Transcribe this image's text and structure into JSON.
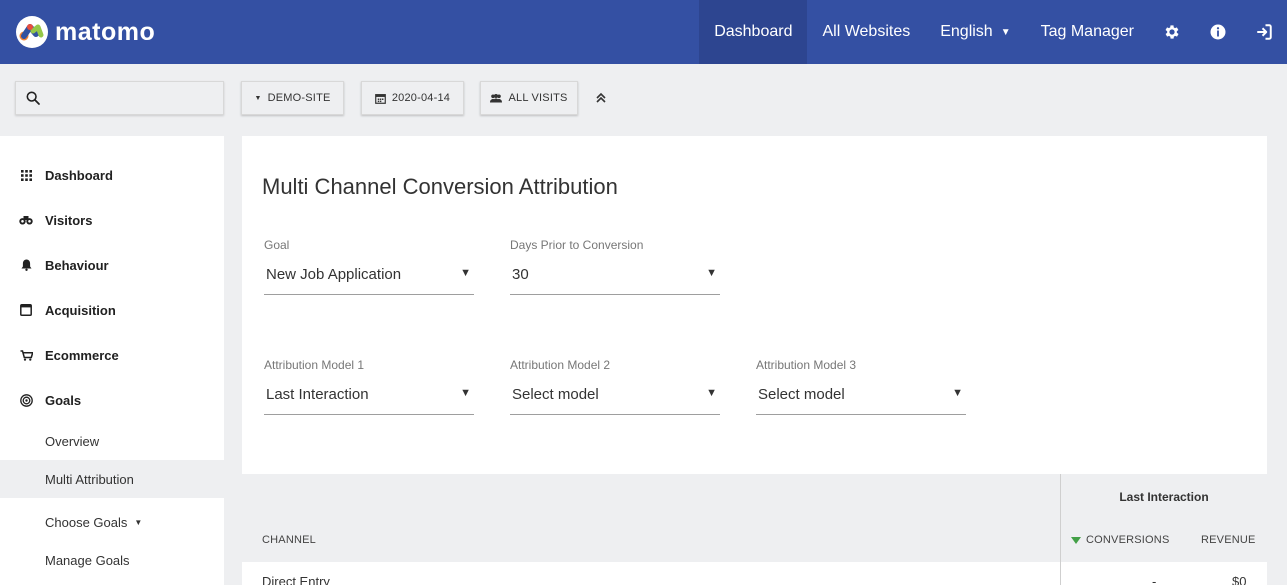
{
  "header": {
    "logo_text": "matomo",
    "nav": {
      "dashboard": "Dashboard",
      "all_websites": "All Websites",
      "language": "English",
      "tag_manager": "Tag Manager"
    },
    "icons": [
      "gear-icon",
      "info-icon",
      "sign-out-icon"
    ]
  },
  "toolbar": {
    "search_placeholder": "",
    "site": "DEMO-SITE",
    "date": "2020-04-14",
    "segment": "ALL VISITS"
  },
  "sidebar": {
    "categories": [
      {
        "label": "Dashboard",
        "icon": "grid-icon"
      },
      {
        "label": "Visitors",
        "icon": "binoculars-icon"
      },
      {
        "label": "Behaviour",
        "icon": "bell-icon"
      },
      {
        "label": "Acquisition",
        "icon": "window-icon"
      },
      {
        "label": "Ecommerce",
        "icon": "cart-icon"
      },
      {
        "label": "Goals",
        "icon": "target-icon"
      }
    ],
    "goals_sub": {
      "overview": "Overview",
      "multi_attribution": "Multi Attribution",
      "choose_goals": "Choose Goals",
      "manage_goals": "Manage Goals"
    }
  },
  "main": {
    "title": "Multi Channel Conversion Attribution",
    "goal": {
      "label": "Goal",
      "value": "New Job Application"
    },
    "days": {
      "label": "Days Prior to Conversion",
      "value": "30"
    },
    "model1": {
      "label": "Attribution Model 1",
      "value": "Last Interaction"
    },
    "model2": {
      "label": "Attribution Model 2",
      "value": "Select model"
    },
    "model3": {
      "label": "Attribution Model 3",
      "value": "Select model"
    },
    "table": {
      "channel_header": "CHANNEL",
      "group_header": "Last Interaction",
      "conversions_header": "CONVERSIONS",
      "revenue_header": "REVENUE",
      "rows": [
        {
          "channel": "Direct Entry",
          "conversions": "-",
          "revenue": "$0"
        }
      ]
    }
  },
  "colors": {
    "header_bg": "#3450a3",
    "header_active": "#2d4590",
    "sort_arrow": "#43a047"
  }
}
